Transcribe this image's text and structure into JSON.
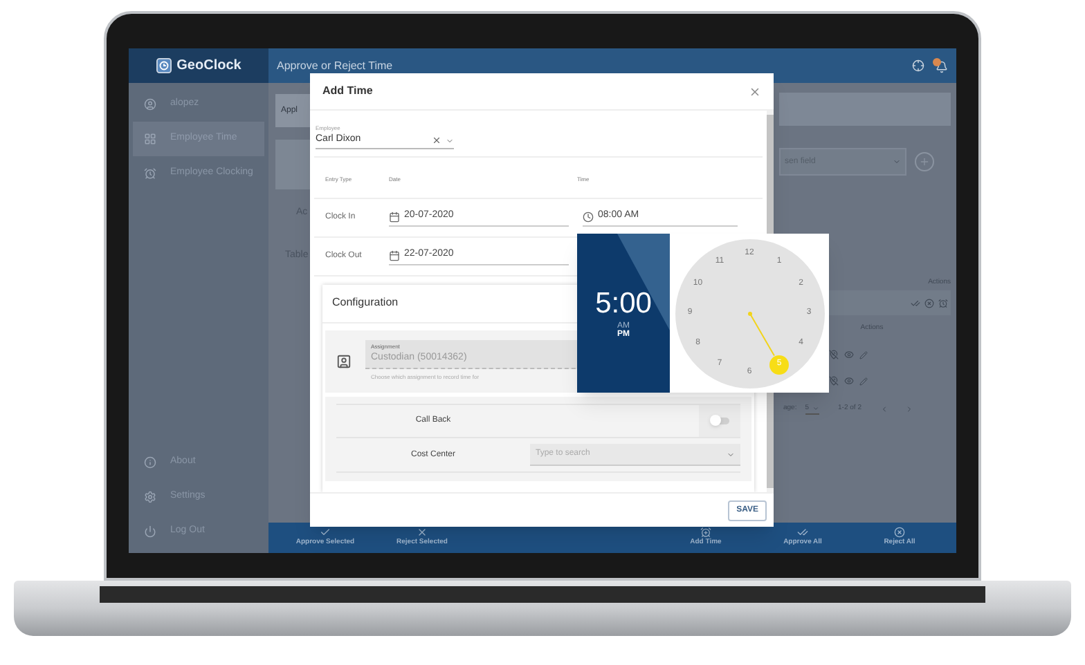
{
  "sidebar": {
    "logo": "GeoClock",
    "items": [
      {
        "label": "alopez",
        "kind": "user",
        "selected": false
      },
      {
        "label": "Employee Time",
        "kind": "grid",
        "selected": true
      },
      {
        "label": "Employee Clocking",
        "kind": "alarm",
        "selected": false
      }
    ],
    "bottom_items": [
      {
        "label": "About",
        "kind": "info"
      },
      {
        "label": "Settings",
        "kind": "gear"
      },
      {
        "label": "Log Out",
        "kind": "power"
      }
    ]
  },
  "header": {
    "title": "Approve or Reject Time"
  },
  "background": {
    "left_fragments": [
      "Appl",
      "Ac",
      "Table"
    ],
    "field_fragment": "sen field",
    "actions_headers": [
      "Actions",
      "Actions"
    ],
    "pagination": {
      "label": "age:",
      "per_page": "5",
      "range": "1-2 of 2"
    }
  },
  "bottom_bar": [
    {
      "label": "Approve Selected",
      "kind": "check"
    },
    {
      "label": "Reject Selected",
      "kind": "x"
    },
    {
      "label": "Add Time",
      "kind": "alarm"
    },
    {
      "label": "Approve All",
      "kind": "double-check"
    },
    {
      "label": "Reject All",
      "kind": "x-circle"
    }
  ],
  "modal": {
    "title": "Add Time",
    "employee": {
      "label": "Employee",
      "value": "Carl Dixon"
    },
    "columns": [
      "Entry Type",
      "Date",
      "Time"
    ],
    "rows": [
      {
        "type": "Clock In",
        "date": "20-07-2020",
        "time": "08:00 AM"
      },
      {
        "type": "Clock Out",
        "date": "22-07-2020"
      }
    ],
    "configuration": {
      "title": "Configuration",
      "assignment": {
        "label": "Assignment",
        "value": "Custodian (50014362)",
        "helper": "Choose which assignment to record time for"
      },
      "call_back": {
        "label": "Call Back",
        "on": false
      },
      "cost_center": {
        "label": "Cost Center",
        "placeholder": "Type to search"
      }
    },
    "save": "SAVE"
  },
  "time_picker": {
    "time": "5:00",
    "periods": [
      {
        "label": "AM",
        "selected": false
      },
      {
        "label": "PM",
        "selected": true
      }
    ],
    "hours": [
      {
        "label": "12",
        "selected": false
      },
      {
        "label": "1",
        "selected": false
      },
      {
        "label": "2",
        "selected": false
      },
      {
        "label": "3",
        "selected": false
      },
      {
        "label": "4",
        "selected": false
      },
      {
        "label": "5",
        "selected": true
      },
      {
        "label": "6",
        "selected": false
      },
      {
        "label": "7",
        "selected": false
      },
      {
        "label": "8",
        "selected": false
      },
      {
        "label": "9",
        "selected": false
      },
      {
        "label": "10",
        "selected": false
      },
      {
        "label": "11",
        "selected": false
      }
    ]
  }
}
